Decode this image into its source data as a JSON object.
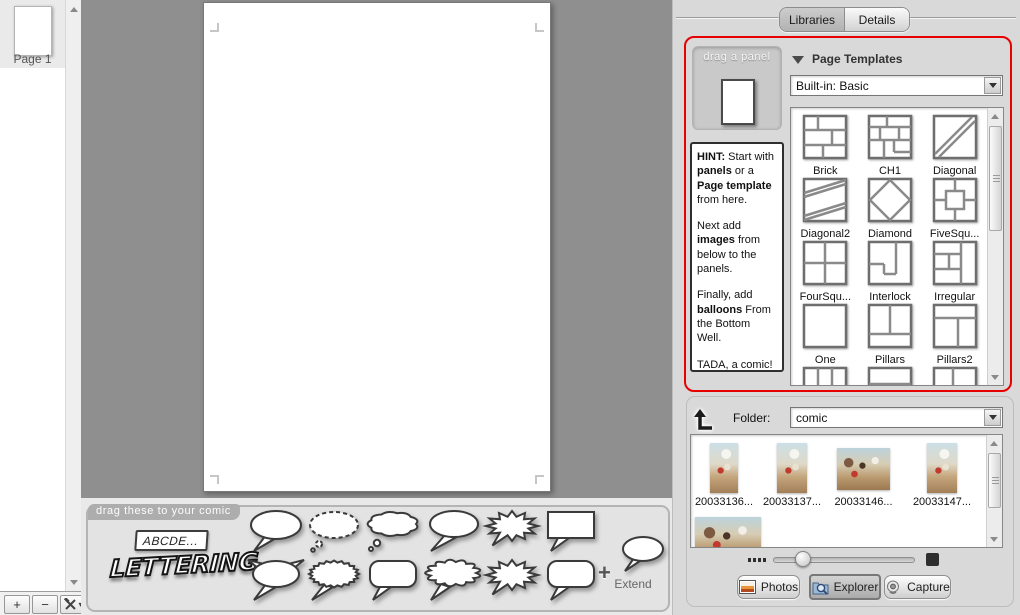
{
  "colors": {
    "accent_red": "#e70000",
    "canvas_bg": "#8f8f8f",
    "panel_bg": "#d9d9d9"
  },
  "pages_sidebar": {
    "pages": [
      {
        "label": "Page 1",
        "selected": true
      }
    ]
  },
  "pages_toolbar": {
    "add_page_label": "+",
    "remove_page_label": "−",
    "tools_icon": "hammer-wrench-icon",
    "tools_caret": "▾"
  },
  "balloon_well": {
    "tab_label": "drag these to your comic",
    "text_box_label": "ABCDE...",
    "lettering_label": "LETTERING",
    "extend_plus_label": "+",
    "extend_label": "Extend",
    "balloons": [
      {
        "name": "oval-speech-balloon",
        "shape": "oval",
        "row": 0
      },
      {
        "name": "dotted-thought-balloon",
        "shape": "dotted",
        "row": 0
      },
      {
        "name": "cloud-thought-balloon",
        "shape": "cloud",
        "row": 0
      },
      {
        "name": "oval-speech-balloon-2",
        "shape": "oval2",
        "row": 0
      },
      {
        "name": "burst-balloon",
        "shape": "burst",
        "row": 0
      },
      {
        "name": "rectangle-speech-balloon",
        "shape": "rect",
        "row": 0
      },
      {
        "name": "horned-oval-balloon",
        "shape": "horned",
        "row": 1
      },
      {
        "name": "zigzag-oval-balloon",
        "shape": "zigzag",
        "row": 1
      },
      {
        "name": "rounded-rect-balloon",
        "shape": "roundrect",
        "row": 1
      },
      {
        "name": "ragged-cloud-balloon",
        "shape": "ragged",
        "row": 1
      },
      {
        "name": "burst-balloon-2",
        "shape": "burst",
        "row": 1
      },
      {
        "name": "rounded-rect-balloon-2",
        "shape": "roundrect",
        "row": 1
      }
    ]
  },
  "right_panel": {
    "tabs": [
      {
        "label": "Libraries",
        "selected": true
      },
      {
        "label": "Details",
        "selected": false
      }
    ],
    "libraries": {
      "drag_panel_label": "drag a panel",
      "hint_paragraphs": [
        [
          {
            "t": "HINT:",
            "b": true
          },
          {
            "t": " Start with "
          },
          {
            "t": "panels",
            "b": true
          },
          {
            "t": " or a "
          },
          {
            "t": "Page template",
            "b": true
          },
          {
            "t": " from here."
          }
        ],
        [
          {
            "t": "Next add "
          },
          {
            "t": "images",
            "b": true
          },
          {
            "t": " from below to the panels."
          }
        ],
        [
          {
            "t": "Finally, add "
          },
          {
            "t": "balloons",
            "b": true
          },
          {
            "t": " From the Bottom Well."
          }
        ],
        [
          {
            "t": "TADA, a comic!"
          }
        ]
      ],
      "templates_header": "Page Templates",
      "collection_value": "Built-in: Basic",
      "templates": [
        {
          "name": "Brick",
          "shape": "brick"
        },
        {
          "name": "CH1",
          "shape": "ch1"
        },
        {
          "name": "Diagonal",
          "shape": "diagonal"
        },
        {
          "name": "Diagonal2",
          "shape": "diagonal2"
        },
        {
          "name": "Diamond",
          "shape": "diamond"
        },
        {
          "name": "FiveSqu...",
          "shape": "fivesqu"
        },
        {
          "name": "FourSqu...",
          "shape": "foursqu"
        },
        {
          "name": "Interlock",
          "shape": "interlock"
        },
        {
          "name": "Irregular",
          "shape": "irregular"
        },
        {
          "name": "One",
          "shape": "one"
        },
        {
          "name": "Pillars",
          "shape": "pillars"
        },
        {
          "name": "Pillars2",
          "shape": "pillars2"
        },
        {
          "name": "",
          "shape": "pillars3"
        },
        {
          "name": "",
          "shape": "strip"
        },
        {
          "name": "",
          "shape": "twocol"
        }
      ]
    },
    "browser": {
      "folder_label": "Folder:",
      "folder_value": "comic",
      "photos": [
        {
          "name": "20033136...",
          "orient": "portrait"
        },
        {
          "name": "20033137...",
          "orient": "portrait"
        },
        {
          "name": "20033146...",
          "orient": "landscape"
        },
        {
          "name": "20033147...",
          "orient": "portrait"
        },
        {
          "name": "",
          "orient": "landscape"
        }
      ],
      "zoom_slider": {
        "value_fraction": 0.19
      },
      "source_buttons": [
        {
          "label": "Photos",
          "icon": "photos-icon",
          "selected": false
        },
        {
          "label": "Explorer",
          "icon": "explorer-icon",
          "selected": true
        },
        {
          "label": "Capture",
          "icon": "capture-icon",
          "selected": false
        }
      ]
    }
  }
}
